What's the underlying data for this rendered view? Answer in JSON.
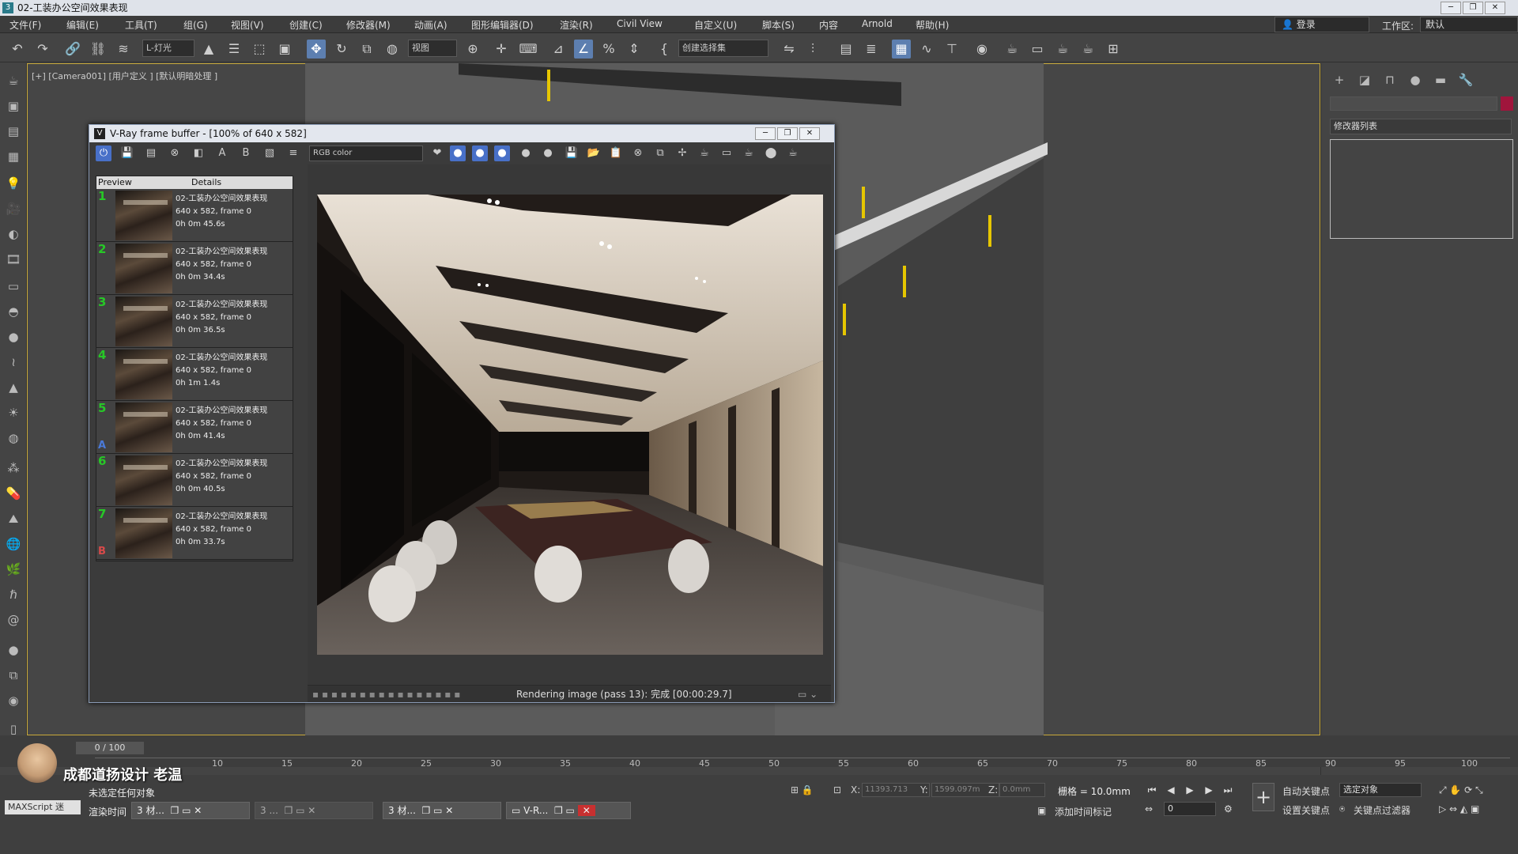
{
  "window": {
    "title": "02-工装办公空间效果表现",
    "min_label": "─",
    "max_label": "❐",
    "close_label": "✕"
  },
  "menu": [
    "文件(F)",
    "编辑(E)",
    "工具(T)",
    "组(G)",
    "视图(V)",
    "创建(C)",
    "修改器(M)",
    "动画(A)",
    "图形编辑器(D)",
    "渲染(R)",
    "Civil View",
    "自定义(U)",
    "脚本(S)",
    "内容",
    "Arnold",
    "帮助(H)"
  ],
  "header_right": {
    "login": "登录",
    "workspace_label": "工作区:",
    "workspace_value": "默认"
  },
  "toolbar": {
    "selection_filter": "L-灯光",
    "reference_coord": "视图",
    "named_selection": "创建选择集"
  },
  "viewport": {
    "label": "[+] [Camera001] [用户定义 ] [默认明暗处理 ]"
  },
  "command_panel": {
    "modifier_list": "修改器列表"
  },
  "vfb": {
    "title": "V-Ray frame buffer - [100% of 640 x 582]",
    "channel": "RGB color",
    "history_headers": {
      "preview": "Preview",
      "details": "Details"
    },
    "history": [
      {
        "num": "1",
        "name": "02-工装办公空间效果表现",
        "res": "640 x 582, frame 0",
        "time": "0h 0m 45.6s",
        "letter": ""
      },
      {
        "num": "2",
        "name": "02-工装办公空间效果表现",
        "res": "640 x 582, frame 0",
        "time": "0h 0m 34.4s",
        "letter": ""
      },
      {
        "num": "3",
        "name": "02-工装办公空间效果表现",
        "res": "640 x 582, frame 0",
        "time": "0h 0m 36.5s",
        "letter": ""
      },
      {
        "num": "4",
        "name": "02-工装办公空间效果表现",
        "res": "640 x 582, frame 0",
        "time": "0h 1m 1.4s",
        "letter": ""
      },
      {
        "num": "5",
        "name": "02-工装办公空间效果表现",
        "res": "640 x 582, frame 0",
        "time": "0h 0m 41.4s",
        "letter": "A"
      },
      {
        "num": "6",
        "name": "02-工装办公空间效果表现",
        "res": "640 x 582, frame 0",
        "time": "0h 0m 40.5s",
        "letter": ""
      },
      {
        "num": "7",
        "name": "02-工装办公空间效果表现",
        "res": "640 x 582, frame 0",
        "time": "0h 0m 33.7s",
        "letter": "B"
      }
    ],
    "status": "Rendering image (pass 13): 完成 [00:00:29.7]"
  },
  "timeline": {
    "frame_counter": "0 / 100",
    "ticks": [
      "10",
      "15",
      "20",
      "25",
      "30",
      "35",
      "40",
      "45",
      "50",
      "55",
      "60",
      "65",
      "70",
      "75",
      "80",
      "85",
      "90",
      "95",
      "100"
    ]
  },
  "status": {
    "watermark": "成都道扬设计 老温",
    "selection": "未选定任何对象",
    "maxscript": "MAXScript 迷",
    "render_time": "渲染时间",
    "x_label": "X:",
    "x_value": "11393.713",
    "y_label": "Y:",
    "y_value": "1599.097m",
    "z_label": "Z:",
    "z_value": "0.0mm",
    "grid": "栅格 = 10.0mm",
    "add_time_tag": "添加时间标记",
    "auto_key": "自动关键点",
    "set_key": "设置关键点",
    "selected_object": "选定对象",
    "key_filters": "关键点过滤器",
    "frame_field": "0"
  },
  "taskbar": [
    {
      "label": "材..."
    },
    {
      "label": "..."
    },
    {
      "label": "材..."
    },
    {
      "label": "V-R..."
    }
  ],
  "colors": {
    "accent": "#c8a93a",
    "vfb_blue": "#4870c8",
    "history_num": "#27c827"
  }
}
